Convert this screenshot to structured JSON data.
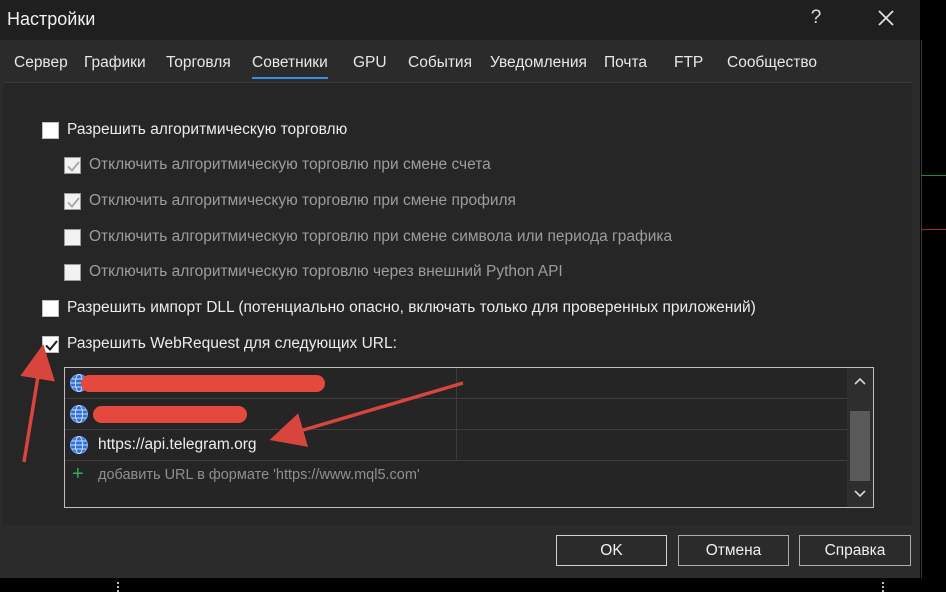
{
  "window": {
    "title": "Настройки",
    "help_label": "?"
  },
  "tabs": [
    {
      "label": "Сервер"
    },
    {
      "label": "Графики"
    },
    {
      "label": "Торговля"
    },
    {
      "label": "Советники",
      "active": true
    },
    {
      "label": "GPU"
    },
    {
      "label": "События"
    },
    {
      "label": "Уведомления"
    },
    {
      "label": "Почта"
    },
    {
      "label": "FTP"
    },
    {
      "label": "Сообщество"
    }
  ],
  "options": {
    "allow_algo": {
      "label": "Разрешить алгоритмическую торговлю",
      "checked": false,
      "enabled": true
    },
    "disable_on_account": {
      "label": "Отключить алгоритмическую торговлю при смене счета",
      "checked": true,
      "enabled": false
    },
    "disable_on_profile": {
      "label": "Отключить алгоритмическую торговлю при смене профиля",
      "checked": true,
      "enabled": false
    },
    "disable_on_symbol": {
      "label": "Отключить алгоритмическую торговлю при смене символа или периода графика",
      "checked": false,
      "enabled": false
    },
    "disable_python": {
      "label": "Отключить алгоритмическую торговлю через внешний Python API",
      "checked": false,
      "enabled": false
    },
    "allow_dll": {
      "label": "Разрешить импорт DLL (потенциально опасно, включать только для проверенных приложений)",
      "checked": false,
      "enabled": true
    },
    "allow_webrequest": {
      "label": "Разрешить WebRequest для следующих URL:",
      "checked": true,
      "enabled": true
    }
  },
  "url_list": {
    "rows": [
      {
        "text": "",
        "redacted": true
      },
      {
        "text": "",
        "redacted": true
      },
      {
        "text": "https://api.telegram.org",
        "redacted": false
      }
    ],
    "add_placeholder": "добавить URL в формате 'https://www.mql5.com'",
    "scroll_up_icon": "chevron-up-icon",
    "scroll_down_icon": "chevron-down-icon"
  },
  "buttons": {
    "ok": "OK",
    "cancel": "Отмена",
    "help": "Справка"
  },
  "colors": {
    "accent": "#3a8ee6",
    "redaction": "#e5483d",
    "annotation_arrow": "#d8453d",
    "add_plus": "#2fae55"
  }
}
